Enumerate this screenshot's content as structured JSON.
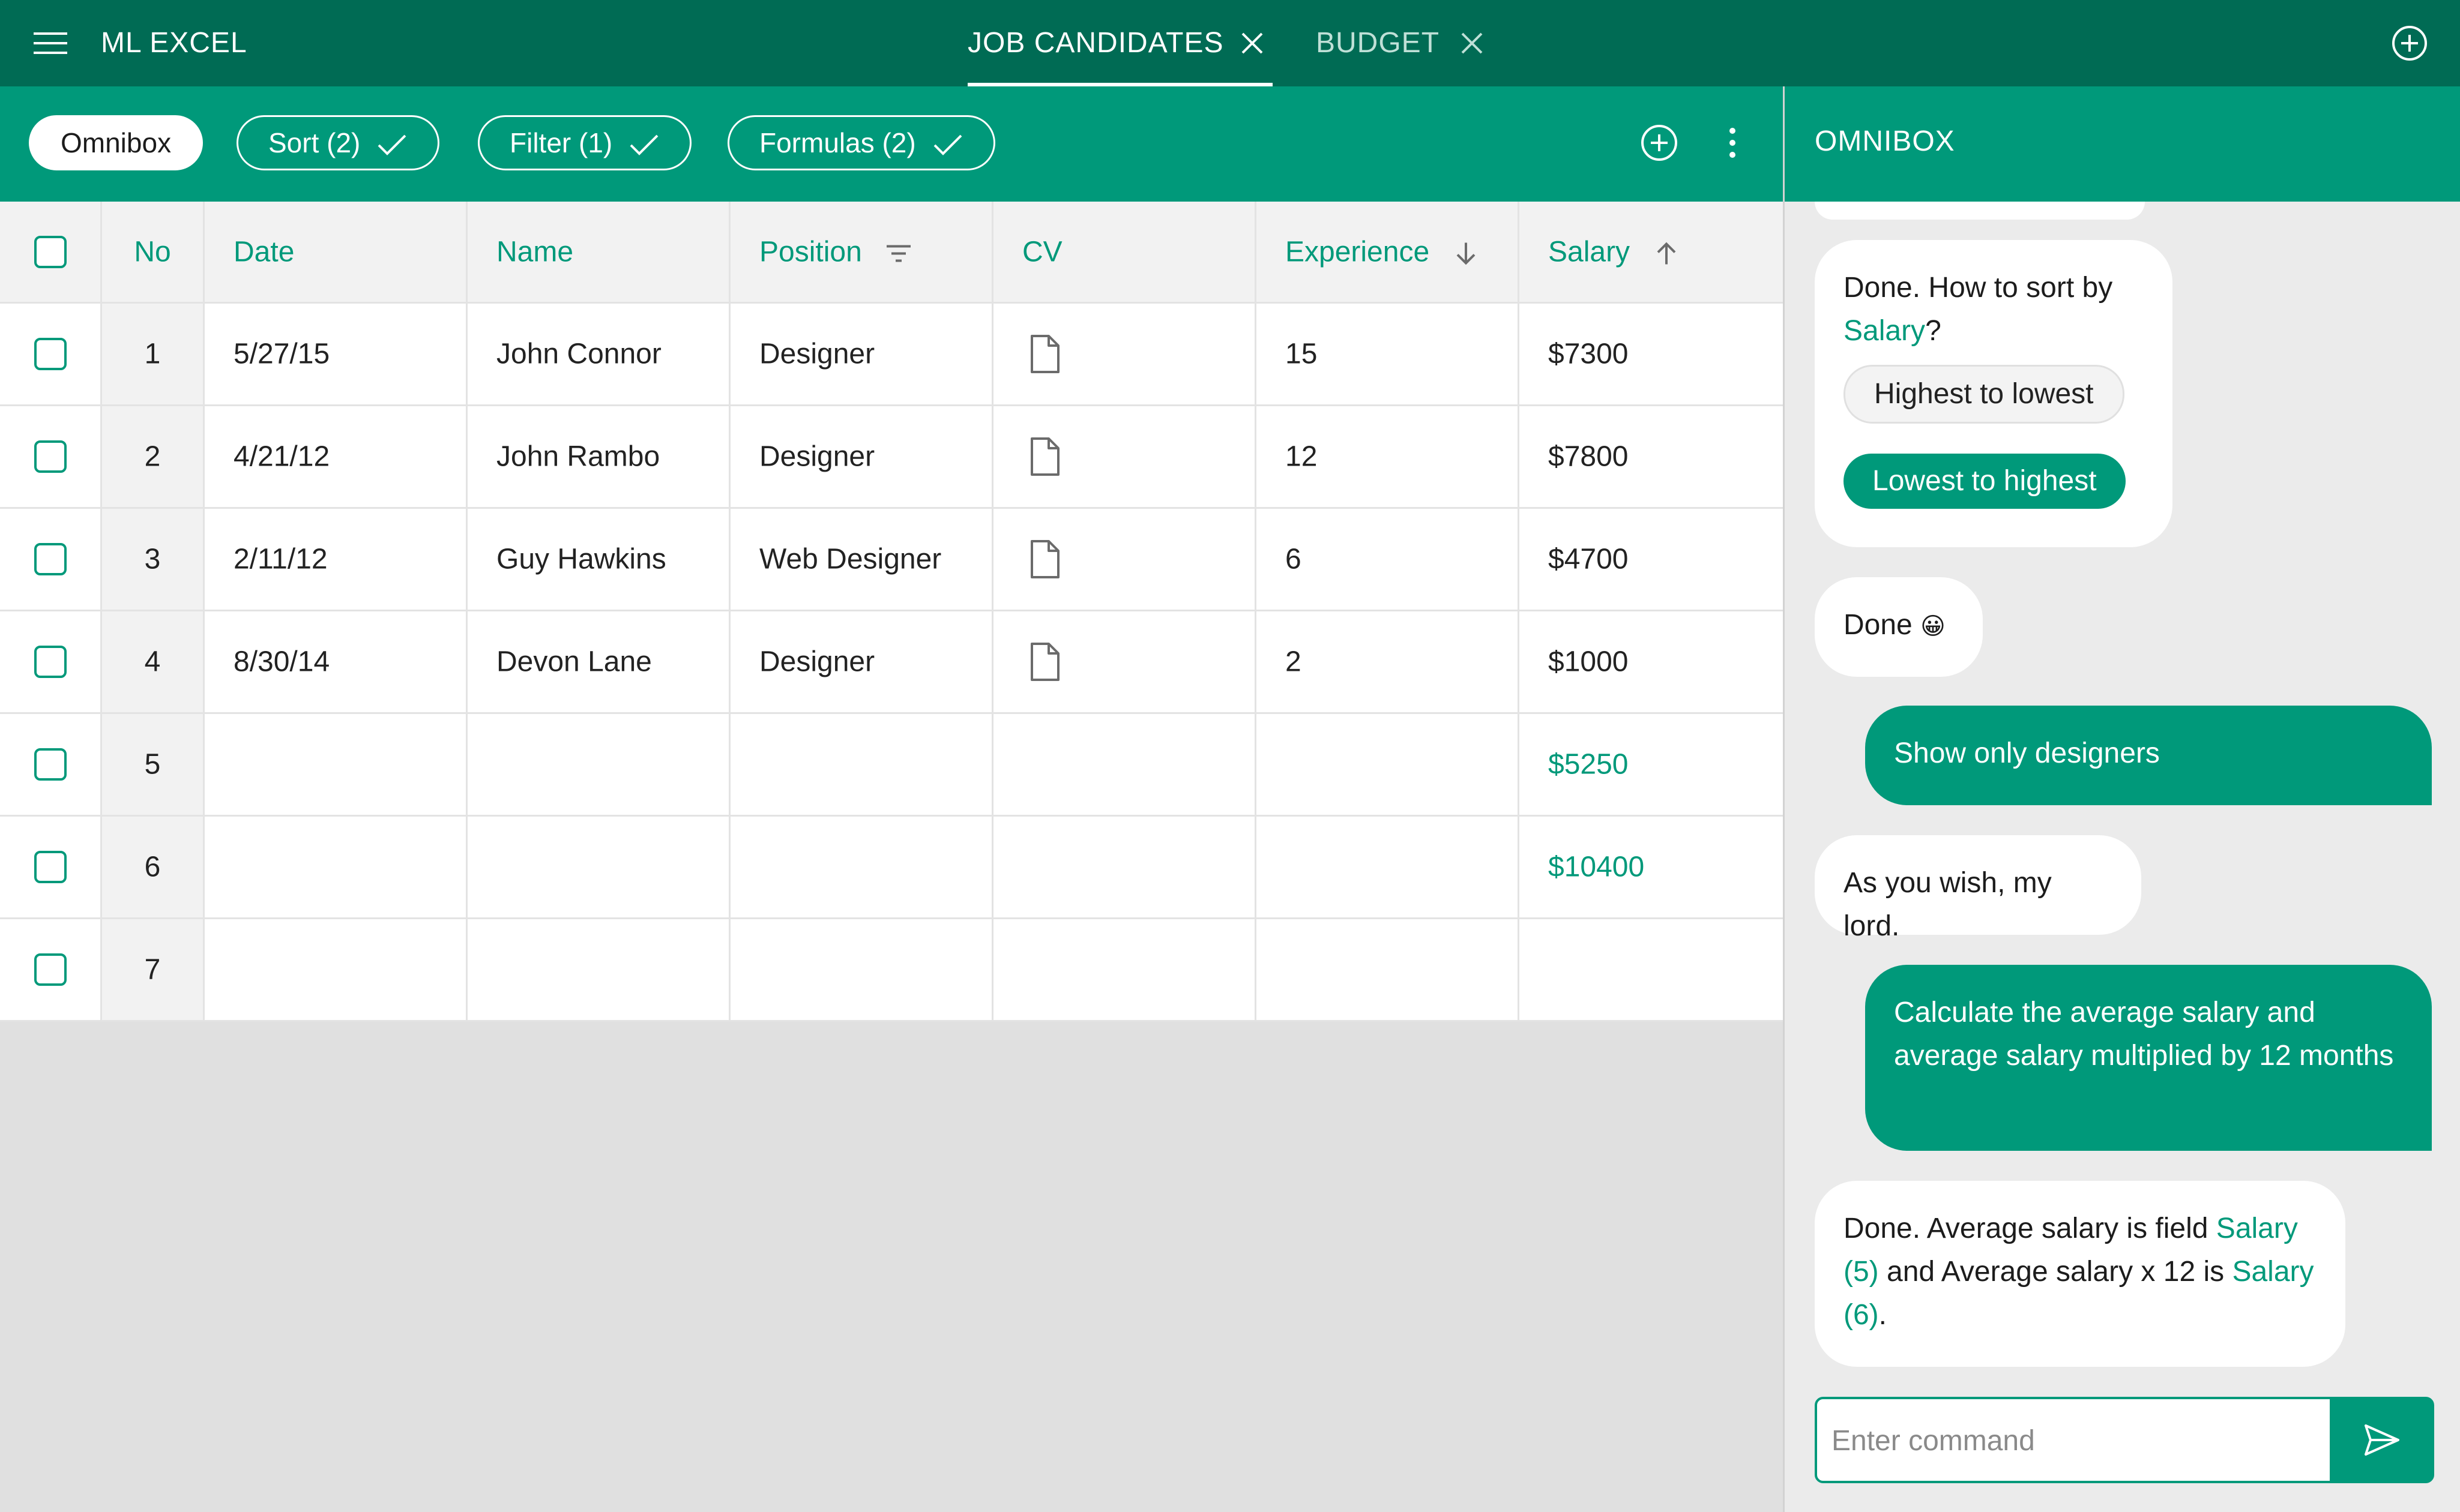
{
  "app": {
    "title": "ML EXCEL",
    "tabs": [
      {
        "label": "JOB CANDIDATES",
        "active": true
      },
      {
        "label": "BUDGET",
        "active": false
      }
    ]
  },
  "toolbar": {
    "chips": [
      {
        "label": "Omnibox",
        "active": true
      },
      {
        "label": "Sort (2)",
        "active": false
      },
      {
        "label": "Filter (1)",
        "active": false
      },
      {
        "label": "Formulas (2)",
        "active": false
      }
    ],
    "icons": [
      "add-circle-icon",
      "more-vert-icon"
    ]
  },
  "table": {
    "columns": [
      "No",
      "Date",
      "Name",
      "Position",
      "CV",
      "Experience",
      "Salary"
    ],
    "column_icons": {
      "Position": "filter-icon",
      "Experience": "sort-desc-icon",
      "Salary": "sort-asc-icon"
    },
    "rows": [
      {
        "no": "1",
        "date": "5/27/15",
        "name": "John Connor",
        "position": "Designer",
        "cv": true,
        "experience": "15",
        "salary": "$7300"
      },
      {
        "no": "2",
        "date": "4/21/12",
        "name": "John Rambo",
        "position": "Designer",
        "cv": true,
        "experience": "12",
        "salary": "$7800"
      },
      {
        "no": "3",
        "date": "2/11/12",
        "name": "Guy Hawkins",
        "position": "Web Designer",
        "cv": true,
        "experience": "6",
        "salary": "$4700"
      },
      {
        "no": "4",
        "date": "8/30/14",
        "name": "Devon Lane",
        "position": "Designer",
        "cv": true,
        "experience": "2",
        "salary": "$1000"
      },
      {
        "no": "5",
        "date": "",
        "name": "",
        "position": "",
        "cv": false,
        "experience": "",
        "salary": "$5250"
      },
      {
        "no": "6",
        "date": "",
        "name": "",
        "position": "",
        "cv": false,
        "experience": "",
        "salary": "$10400"
      },
      {
        "no": "7",
        "date": "",
        "name": "",
        "position": "",
        "cv": false,
        "experience": "",
        "salary": ""
      }
    ]
  },
  "omnibox": {
    "title": "OMNIBOX",
    "messages": {
      "sort_question_prefix": "Done. How to sort by ",
      "sort_question_field": "Salary",
      "sort_question_suffix": "?",
      "option_high_low": "Highest to lowest",
      "option_low_high": "Lowest to highest",
      "done": "Done",
      "done_emoji": "😀",
      "user_designers": "Show only designers",
      "bot_wish": "As you wish, my lord.",
      "user_calc": "Calculate the average salary and average salary multiplied by 12 months",
      "result_a": "Done. Average salary is field ",
      "result_field_1": "Salary (5)",
      "result_b": " and Average salary x 12 is ",
      "result_field_2": "Salary (6)",
      "result_c": "."
    },
    "input_placeholder": "Enter command",
    "accent": "#00997a",
    "appbar_color": "#006b54"
  }
}
